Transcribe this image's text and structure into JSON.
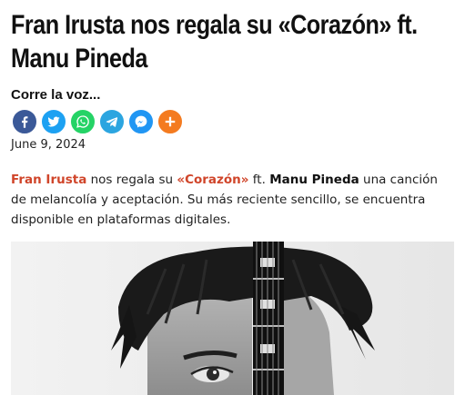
{
  "article": {
    "title_line1": "Fran Irusta nos regala su «Corazón» ft.",
    "title_line2": "Manu Pineda",
    "date": "June 9, 2024"
  },
  "share": {
    "heading": "Corre la voz...",
    "buttons": [
      {
        "icon": "facebook-icon",
        "color": "#3b5998"
      },
      {
        "icon": "twitter-icon",
        "color": "#1da1f2"
      },
      {
        "icon": "whatsapp-icon",
        "color": "#25d366"
      },
      {
        "icon": "telegram-icon",
        "color": "#2ca5e0"
      },
      {
        "icon": "messenger-icon",
        "color": "#2196f3"
      },
      {
        "icon": "plus-icon",
        "color": "#f47b20"
      }
    ]
  },
  "lead": {
    "artist": "Fran Irusta",
    "text1": " nos regala su ",
    "song": "«Corazón»",
    "text2": " ft. ",
    "featured": "Manu Pineda",
    "text3": " una canción de melancolía y aceptación. Su más reciente sencillo, se encuentra disponible en plataformas digitales."
  },
  "colors": {
    "accent": "#d0452a"
  },
  "image": {
    "subject": "black-and-white portrait with guitar neck"
  }
}
